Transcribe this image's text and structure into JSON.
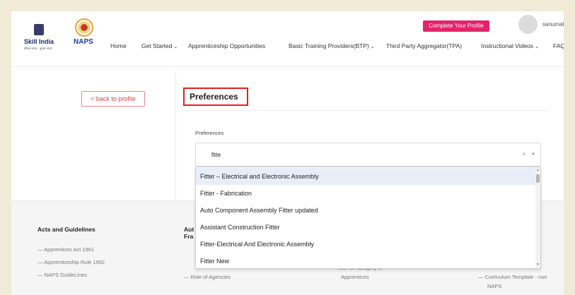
{
  "header": {
    "logo_skill_india": "Skill India",
    "logo_skill_india_sub": "कौशल भारत - कुशल भारत",
    "logo_naps": "NAPS",
    "logo_naps_sub": "",
    "cta_label": "Complete Your Profile",
    "username": "sanumat",
    "nav": [
      {
        "label": "Home"
      },
      {
        "label": "Get Started"
      },
      {
        "label": "Apprenticeship Opportunities"
      },
      {
        "label": "Basic Training Providers(BTP)"
      },
      {
        "label": "Third Party Aggregator(TPA)"
      },
      {
        "label": "Instructional Videos"
      },
      {
        "label": "FAQ"
      }
    ]
  },
  "sidebar": {
    "back_label": "< back to profile"
  },
  "main": {
    "section_title": "Preferences",
    "field_label": "Preferences",
    "search_value": "fitte",
    "clear_icon": "×",
    "arrow_icon": "▲",
    "options": [
      "Fitter – Electrical and Electronic Assembly",
      "Fitter - Fabrication",
      "Auto Component Assembly Fitter updated",
      "Assistant Construction Fitter",
      "Fitter-Electrical And Electronic Assembly",
      "Fitter New"
    ]
  },
  "footer": {
    "col1_title": "Acts and Guidelines",
    "col1_links": [
      "Apprentices Act 1961",
      "Apprenticeship Rule 1992",
      "NAPS GuideLines"
    ],
    "col2_title_1": "Aut",
    "col2_title_2": "Fra",
    "col2_links": [
      "Role of Agencies"
    ],
    "col3_links": [
      "Use for category of",
      "Apprentices"
    ],
    "col4_links": [
      "Curriculum Template - non",
      "NAPS"
    ]
  },
  "colors": {
    "accent": "#e3236a",
    "highlight_border": "#e02020",
    "back_button": "#d24545"
  }
}
